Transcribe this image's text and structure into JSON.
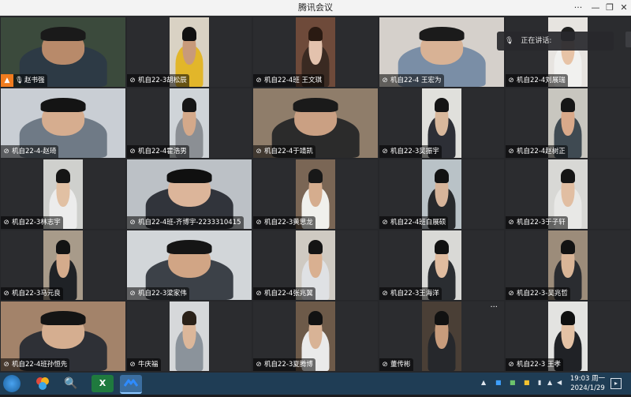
{
  "window": {
    "title": "腾讯会议",
    "controls": [
      "···",
      "—",
      "❐",
      "✕"
    ]
  },
  "speaking_label": "正在讲话:",
  "participants": [
    "赵书强",
    "机自22-3胡松辰",
    "机自22-4班 王文琪",
    "机自22-4 王宏为",
    "机自22-4刘展瑞",
    "机自22-4-赵琦",
    "机自22-4霍浩男",
    "机自22-4于靖凯",
    "机自22-3吴振宇",
    "机自22-4赵树正",
    "机自22-3林志宇",
    "机自22-4班-齐博宇-2233310415",
    "机自22-3黄思龙",
    "机自22-4班白展硕",
    "机自22-3于子轩",
    "机自22-3马元良",
    "机自22-3梁家伟",
    "机自22-4张兆翼",
    "机自22-3王海洋",
    "机自22-3-吴兆哲",
    "机自22-4班孙恒先",
    "牛庆福",
    "机自22-3夏腾博",
    "董传彬",
    "机自22-3 王孝"
  ],
  "tile_menu": "···",
  "taskbar": {
    "time": "19:03 周一",
    "date": "2024/1/29",
    "apps": [
      "start-icon",
      "colorful-app-icon",
      "search-app-icon",
      "excel-icon",
      "tencent-meeting-icon"
    ]
  }
}
